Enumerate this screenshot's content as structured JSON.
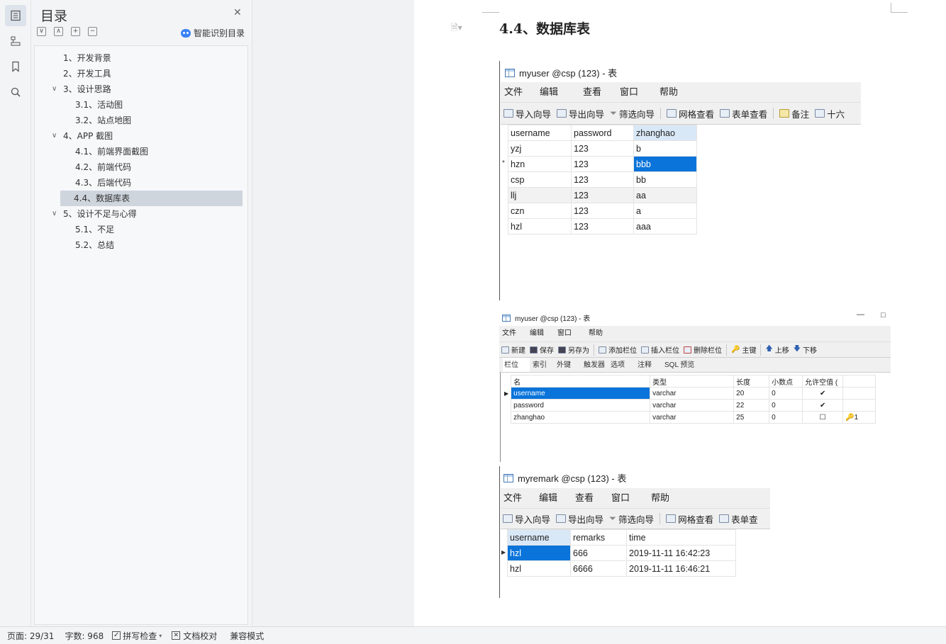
{
  "rail": {
    "icons": [
      "toc-icon",
      "structure-icon",
      "bookmark-icon",
      "search-icon"
    ]
  },
  "toc": {
    "title": "目录",
    "smart_label": "智能识别目录",
    "tool_buttons": [
      "∨",
      "∧",
      "+",
      "−"
    ],
    "items": [
      {
        "label": "1、开发背景",
        "level": 1,
        "expandable": false
      },
      {
        "label": "2、开发工具",
        "level": 1,
        "expandable": false
      },
      {
        "label": "3、设计思路",
        "level": 1,
        "expandable": true
      },
      {
        "label": "3.1、活动图",
        "level": 2,
        "expandable": false
      },
      {
        "label": "3.2、站点地图",
        "level": 2,
        "expandable": false
      },
      {
        "label": "4、APP 截图",
        "level": 1,
        "expandable": true
      },
      {
        "label": "4.1、前端界面截图",
        "level": 2,
        "expandable": false
      },
      {
        "label": "4.2、前端代码",
        "level": 2,
        "expandable": false
      },
      {
        "label": "4.3、后端代码",
        "level": 2,
        "expandable": false
      },
      {
        "label": "4.4、数据库表",
        "level": 2,
        "expandable": false,
        "selected": true
      },
      {
        "label": "5、设计不足与心得",
        "level": 1,
        "expandable": true
      },
      {
        "label": "5.1、不足",
        "level": 2,
        "expandable": false
      },
      {
        "label": "5.2、总结",
        "level": 2,
        "expandable": false
      }
    ]
  },
  "doc": {
    "heading": "4.4、数据库表",
    "shot1": {
      "title": "myuser @csp (123) - 表",
      "menu": [
        "文件",
        "编辑",
        "查看",
        "窗口",
        "帮助"
      ],
      "toolbar": [
        "导入向导",
        "导出向导",
        "筛选向导",
        "网格查看",
        "表单查看",
        "备注",
        "十六"
      ],
      "columns": [
        "username",
        "password",
        "zhanghao"
      ],
      "rows": [
        [
          "yzj",
          "123",
          "b"
        ],
        [
          "hzn",
          "123",
          "bbb"
        ],
        [
          "csp",
          "123",
          "bb"
        ],
        [
          "llj",
          "123",
          "aa"
        ],
        [
          "czn",
          "123",
          "a"
        ],
        [
          "hzl",
          "123",
          "aaa"
        ]
      ],
      "current_row_marker": "*"
    },
    "shot2": {
      "title": "myuser @csp (123) - 表",
      "window_buttons": [
        "—",
        "□"
      ],
      "menu": [
        "文件",
        "编辑",
        "窗口",
        "帮助"
      ],
      "toolbar": [
        "新建",
        "保存",
        "另存为",
        "添加栏位",
        "插入栏位",
        "删除栏位",
        "主键",
        "上移",
        "下移"
      ],
      "tabs": [
        "栏位",
        "索引",
        "外键",
        "触发器",
        "选项",
        "注释",
        "SQL 预览"
      ],
      "columns": [
        "名",
        "类型",
        "长度",
        "小数点",
        "允许空值 ("
      ],
      "rows": [
        {
          "name": "username",
          "type": "varchar",
          "length": "20",
          "decimals": "0",
          "nullable": "✔",
          "key": ""
        },
        {
          "name": "password",
          "type": "varchar",
          "length": "22",
          "decimals": "0",
          "nullable": "✔",
          "key": ""
        },
        {
          "name": "zhanghao",
          "type": "varchar",
          "length": "25",
          "decimals": "0",
          "nullable": "☐",
          "key": "🔑1"
        }
      ]
    },
    "shot3": {
      "title": "myremark @csp (123) - 表",
      "menu": [
        "文件",
        "编辑",
        "查看",
        "窗口",
        "帮助"
      ],
      "toolbar": [
        "导入向导",
        "导出向导",
        "筛选向导",
        "网格查看",
        "表单查"
      ],
      "columns": [
        "username",
        "remarks",
        "time"
      ],
      "rows": [
        [
          "hzl",
          "666",
          "2019-11-11 16:42:23"
        ],
        [
          "hzl",
          "6666",
          "2019-11-11 16:46:21"
        ]
      ]
    }
  },
  "status": {
    "page": "页面: 29/31",
    "words": "字数: 968",
    "spell": "拼写检查",
    "proof": "文档校对",
    "compat": "兼容模式"
  }
}
